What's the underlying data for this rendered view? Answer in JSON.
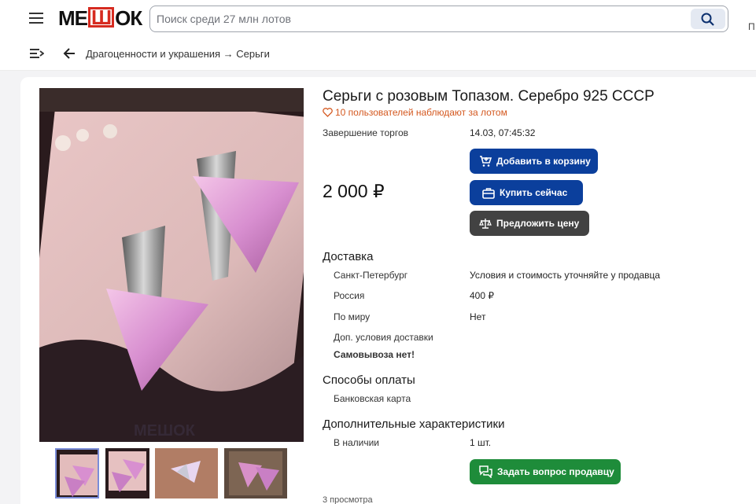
{
  "header": {
    "logo": "МЕШОК",
    "search_placeholder": "Поиск среди 27 млн лотов",
    "cut_text": "П"
  },
  "subnav": {
    "breadcrumb": "Драгоценности и украшения → Серьги"
  },
  "lot": {
    "title": "Серьги с розовым Топазом. Серебро 925 СССР",
    "watchers": "10 пользователей наблюдают за лотом",
    "end_label": "Завершение торгов",
    "end_value": "14.03, 07:45:32",
    "price": "2 000 ₽",
    "add_to_cart": "Добавить в корзину",
    "buy_now": "Купить сейчас",
    "make_offer": "Предложить цену"
  },
  "delivery": {
    "heading": "Доставка",
    "rows": [
      {
        "label": "Санкт-Петербург",
        "value": "Условия и стоимость уточняйте у продавца"
      },
      {
        "label": "Россия",
        "value": "400 ₽"
      },
      {
        "label": "По миру",
        "value": "Нет"
      }
    ],
    "extra_label": "Доп. условия доставки",
    "extra_value": "Самовывоза нет!"
  },
  "payment": {
    "heading": "Способы оплаты",
    "method": "Банковская карта"
  },
  "characteristics": {
    "heading": "Дополнительные характеристики",
    "stock_label": "В наличии",
    "stock_value": "1 шт."
  },
  "ask_seller": "Задать вопрос продавцу",
  "views": "3 просмотра",
  "watermark": "МЕШОК",
  "colors": {
    "brand_red": "#d62b20",
    "primary_blue": "#0b3f9c",
    "offer_gray": "#424242",
    "ask_green": "#1e8c3a",
    "watch_orange": "#d4581f"
  }
}
